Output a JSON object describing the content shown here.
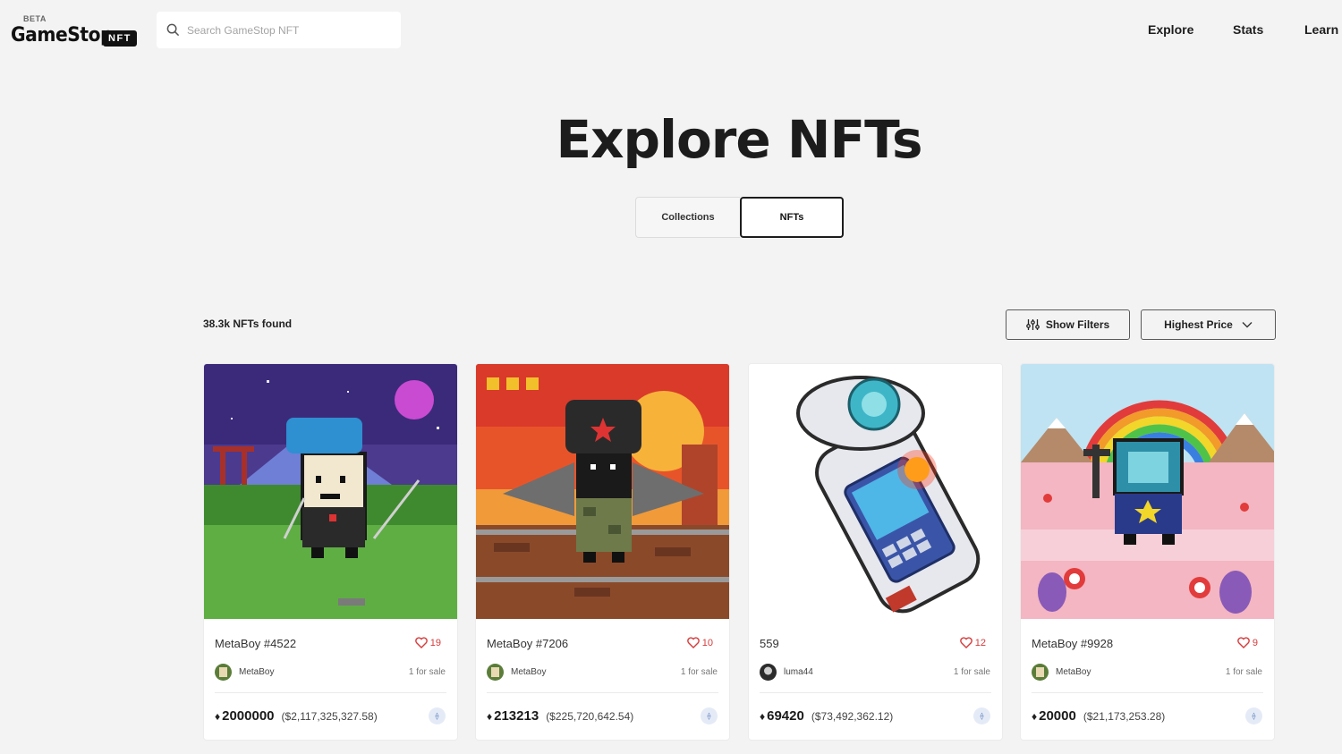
{
  "header": {
    "logo_beta": "BETA",
    "logo_word": "GameStop",
    "logo_tag": "NFT",
    "search_placeholder": "Search GameStop NFT",
    "nav": [
      "Explore",
      "Stats",
      "Learn"
    ]
  },
  "hero": {
    "title": "Explore NFTs",
    "tabs": [
      {
        "label": "Collections",
        "selected": false
      },
      {
        "label": "NFTs",
        "selected": true
      }
    ]
  },
  "results": {
    "count_text": "38.3k NFTs found",
    "filter_label": "Show Filters",
    "sort_label": "Highest Price"
  },
  "cards": [
    {
      "name": "MetaBoy #4522",
      "likes": "19",
      "creator": "MetaBoy",
      "for_sale": "1 for sale",
      "price": "2000000",
      "usd": "($2,117,325,327.58)",
      "art": "metaboy-ninja"
    },
    {
      "name": "MetaBoy #7206",
      "likes": "10",
      "creator": "MetaBoy",
      "for_sale": "1 for sale",
      "price": "213213",
      "usd": "($225,720,642.54)",
      "art": "metaboy-bat"
    },
    {
      "name": "559",
      "likes": "12",
      "creator": "luma44",
      "for_sale": "1 for sale",
      "price": "69420",
      "usd": "($73,492,362.12)",
      "art": "astronaut-glove"
    },
    {
      "name": "MetaBoy #9928",
      "likes": "9",
      "creator": "MetaBoy",
      "for_sale": "1 for sale",
      "price": "20000",
      "usd": "($21,173,253.28)",
      "art": "metaboy-rainbow"
    }
  ],
  "colors": {
    "background": "#f3f3f3",
    "like_red": "#d63b3b",
    "text_dark": "#1c1c1c"
  }
}
